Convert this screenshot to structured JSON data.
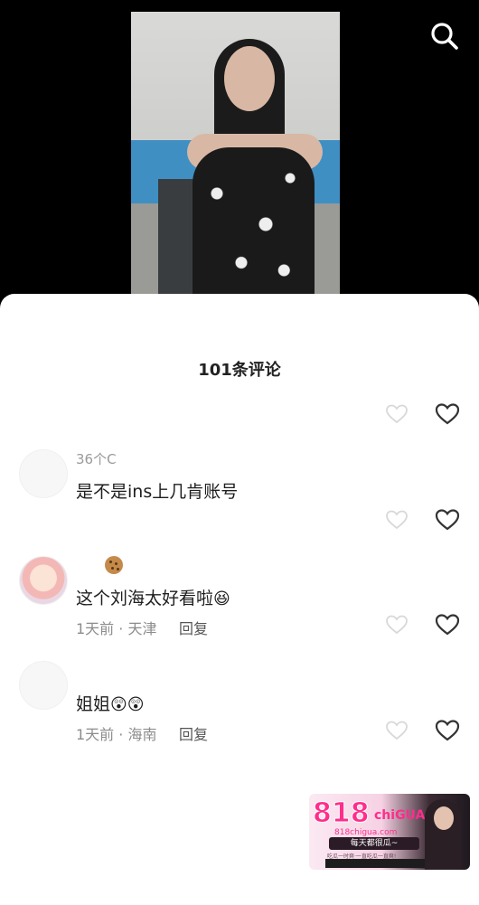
{
  "comments_header": {
    "count_label": "101条评论"
  },
  "comments": [
    {
      "username": "",
      "text": "",
      "meta": "",
      "reply_label": ""
    },
    {
      "username": "36个C",
      "text": "是不是ins上几肯账号",
      "meta": "",
      "reply_label": ""
    },
    {
      "username": "",
      "text": "这个刘海太好看啦",
      "meta": "1天前 · 天津",
      "reply_label": "回复"
    },
    {
      "username": "",
      "text": "姐姐",
      "meta": "1天前 · 海南",
      "reply_label": "回复"
    }
  ],
  "ad": {
    "logo_text": "818",
    "logo_suffix": "chiGUA",
    "url": "818chigua.com",
    "tagline": "每天都很瓜~",
    "subline": "吃瓜一时爽·一直吃瓜一直爽!"
  },
  "icons": {
    "search": "search-icon",
    "like": "heart-outline-icon"
  },
  "colors": {
    "sheet_background": "#ffffff",
    "heart_stroke": "#333333",
    "heart_dim": "#d8d8d8",
    "meta_text": "#8c8c8c",
    "ad_accent": "#ff2d8c"
  }
}
